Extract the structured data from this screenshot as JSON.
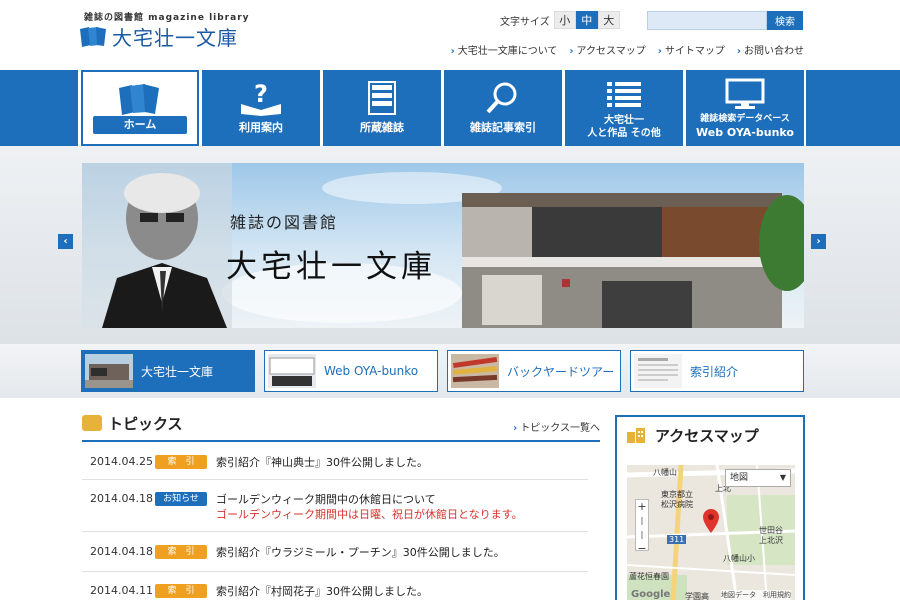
{
  "header": {
    "logo_sub": "雑誌の図書館 magazine library",
    "logo_main": "大宅壮一文庫",
    "font_size_label": "文字サイズ",
    "font_sizes": [
      "小",
      "中",
      "大"
    ],
    "font_size_selected": "中",
    "search_button": "検索",
    "util_links": [
      "大宅壮一文庫について",
      "アクセスマップ",
      "サイトマップ",
      "お問い合わせ"
    ]
  },
  "nav": {
    "items": [
      {
        "label": "ホーム",
        "icon": "magazines-icon",
        "active": true
      },
      {
        "label": "利用案内",
        "icon": "question-book-icon"
      },
      {
        "label": "所蔵雑誌",
        "icon": "bookshelf-icon"
      },
      {
        "label": "雑誌記事索引",
        "icon": "magnifier-icon"
      },
      {
        "label_line1": "大宅壮一",
        "label_line2": "人と作品 その他",
        "icon": "list-icon"
      },
      {
        "label_line1": "雑誌検索データベース",
        "label_line2": "Web OYA-bunko",
        "icon": "monitor-icon"
      }
    ]
  },
  "hero": {
    "subtitle": "雑誌の図書館",
    "title": "大宅壮一文庫"
  },
  "banners": [
    {
      "label": "大宅壮一文庫",
      "active": true
    },
    {
      "label": "Web OYA-bunko"
    },
    {
      "label": "バックヤードツアー"
    },
    {
      "label": "索引紹介"
    }
  ],
  "topics": {
    "title": "トピックス",
    "more": "トピックス一覧へ",
    "items": [
      {
        "date": "2014.04.25",
        "badge": "索　引",
        "badge_type": "index",
        "text": "索引紹介『神山典士』30件公開しました。"
      },
      {
        "date": "2014.04.18",
        "badge": "お知らせ",
        "badge_type": "notice",
        "text": "ゴールデンウィーク期間中の休館日について",
        "text2": "ゴールデンウィーク期間中は日曜、祝日が休館日となります。"
      },
      {
        "date": "2014.04.18",
        "badge": "索　引",
        "badge_type": "index",
        "text": "索引紹介『ウラジミール・プーチン』30件公開しました。"
      },
      {
        "date": "2014.04.11",
        "badge": "索　引",
        "badge_type": "index",
        "text": "索引紹介『村岡花子』30件公開しました。"
      }
    ]
  },
  "access": {
    "title": "アクセスマップ",
    "map_type": "地図",
    "labels": [
      "八幡山",
      "上北",
      "東京都立",
      "松沢病院",
      "世田谷",
      "上北沢",
      "八幡山小",
      "蘆花恒春園",
      "311"
    ],
    "google": "Google",
    "footer_data": "地図データ",
    "footer_terms": "利用規約",
    "school_label": "学園高"
  },
  "colors": {
    "primary": "#1d6fbb",
    "badge_index": "#f0a020",
    "alert_red": "#d9332b"
  }
}
